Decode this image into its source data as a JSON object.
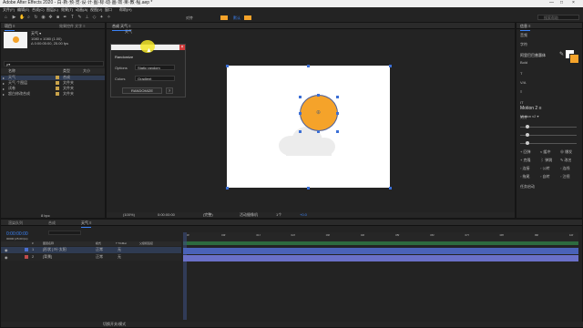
{
  "titlebar": {
    "title": "Adobe After Effects 2020 - 白·新·预·览·设·计·图·标·动·画·效·果·教·程.aep *"
  },
  "menu": [
    "文件(F)",
    "编辑(E)",
    "合成(C)",
    "图层(L)",
    "效果(T)",
    "动画(A)",
    "视图(V)",
    "窗口",
    "帮助(H)"
  ],
  "toolbar": {
    "snap_label": "对齐",
    "default_label": "默认",
    "search_placeholder": "搜索帮助"
  },
  "project_panel": {
    "tabs": [
      "项目 ≡",
      "效果控件 文字 ≡"
    ],
    "comp_name": "天气 ▾",
    "comp_info": "1080 x 1080 (1.00)",
    "comp_duration": "Δ 0:00:05:00, 25.00 fps",
    "search_placeholder": "ρ▾",
    "columns": [
      "名称",
      "类型",
      "大小"
    ],
    "items": [
      {
        "name": "天气",
        "type": "合成",
        "color": "#c9a34a"
      },
      {
        "name": "天气 个图层",
        "type": "文件夹",
        "color": "#c9a34a"
      },
      {
        "name": "试卷",
        "type": "文件夹",
        "color": "#c9a34a"
      },
      {
        "name": "超白修改合成",
        "type": "文件夹",
        "color": "#c9a34a"
      }
    ],
    "bpc": "8 bpc"
  },
  "comp_panel": {
    "tabs": [
      "合成 天气 ≡"
    ],
    "breadcrumb": "天气",
    "footer": {
      "zoom": "(100%)",
      "time": "0:00:00:00",
      "res": "(完整)",
      "camera": "活动摄像机",
      "views": "1个",
      "plus": "+0.0"
    }
  },
  "randomize_dialog": {
    "title": "Randomize",
    "fields": [
      {
        "label": "Options",
        "value": "Static random"
      },
      {
        "label": "Colors",
        "value": "Gradient"
      }
    ],
    "button": "RANDOMIZE",
    "close": "×",
    "help": "?"
  },
  "right_panel": {
    "tabs": [
      "信息 ≡"
    ],
    "section_labels": [
      "音频",
      "字符",
      "对齐"
    ],
    "font": "阿里巴巴普惠体",
    "font_style": "Bold",
    "motion_title": "Motion 2 ≡",
    "motion_sub": "Motion v2 ▾",
    "effects": [
      {
        "icon": "+",
        "label": "回弹"
      },
      {
        "icon": "≈",
        "label": "缓冲"
      },
      {
        "icon": "⊕",
        "label": "爆发"
      },
      {
        "icon": "+",
        "label": "克隆"
      },
      {
        "icon": "⌇",
        "label": "弹跳"
      },
      {
        "icon": "✎",
        "label": "改名"
      },
      {
        "icon": "◦",
        "label": "连接"
      },
      {
        "icon": "◦",
        "label": "公转"
      },
      {
        "icon": "◦",
        "label": "连线"
      },
      {
        "icon": "◦",
        "label": "拖尾"
      },
      {
        "icon": "◦",
        "label": "自转"
      },
      {
        "icon": "◦",
        "label": "注视"
      }
    ],
    "footer": "任务启动"
  },
  "timeline": {
    "tabs": [
      "渲染队列",
      "合成",
      "天气 ≡"
    ],
    "time": "0:00:00:00",
    "fps": "00000 (25.00 fps)",
    "columns": [
      "#",
      "图层名称",
      "模式",
      "T TrkMat",
      "父级和链接"
    ],
    "layers": [
      {
        "num": "1",
        "name": "[形状 ] 叶·太阳",
        "mode": "正常",
        "trk": "无",
        "color": "#4a6fd1"
      },
      {
        "num": "2",
        "name": "[背景]",
        "mode": "正常",
        "trk": "无",
        "color": "#c14b4b"
      }
    ],
    "ruler": [
      "0f",
      "00f",
      "01f",
      "02f",
      "03f",
      "04f",
      "05f",
      "06f",
      "07f",
      "08f",
      "09f",
      "10f"
    ],
    "footer": "切换开关/模式"
  },
  "colors": {
    "accent": "#3b82f6",
    "sun": "#f5a32a",
    "cloud": "#ececec",
    "selection": "#4b5f9b"
  }
}
